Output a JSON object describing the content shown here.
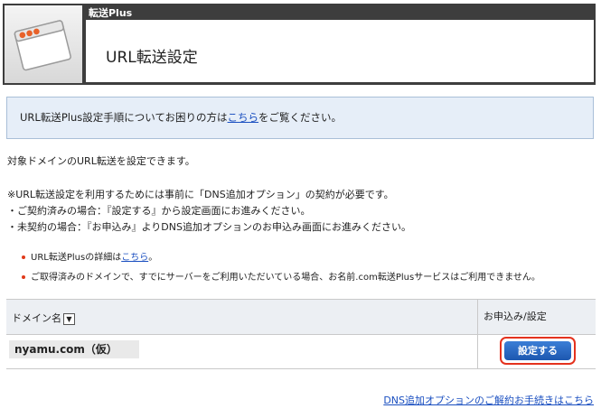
{
  "header": {
    "category": "転送Plus",
    "title": "URL転送設定",
    "icon": "window-app-icon"
  },
  "notice": {
    "before": "URL転送Plus設定手順についてお困りの方は",
    "link": "こちら",
    "after": "をご覧ください。"
  },
  "intro": "対象ドメインのURL転送を設定できます。",
  "requirements": [
    "※URL転送設定を利用するためには事前に「DNS追加オプション」の契約が必要です。",
    "・ご契約済みの場合：『設定する』から設定画面にお進みください。",
    "・未契約の場合：『お申込み』よりDNS追加オプションのお申込み画面にお進みください。"
  ],
  "bullets": {
    "detail_before": "URL転送Plusの詳細は",
    "detail_link": "こちら",
    "detail_after": "。",
    "warning": "ご取得済みのドメインで、すでにサーバーをご利用いただいている場合、お名前.com転送Plusサービスはご利用できません。"
  },
  "table": {
    "col_domain": "ドメイン名",
    "sort_icon": "▼",
    "col_action": "お申込み/設定",
    "rows": [
      {
        "domain": "nyamu.com（仮）",
        "action": "設定する"
      }
    ]
  },
  "footer_link": "DNS追加オプションのご解約お手続きはこちら",
  "colors": {
    "header_bg": "#3d3d3d",
    "notice_bg": "#e6eef8",
    "button_bg": "#2a68c4",
    "highlight": "#e4321e",
    "link": "#1a4fc0"
  }
}
